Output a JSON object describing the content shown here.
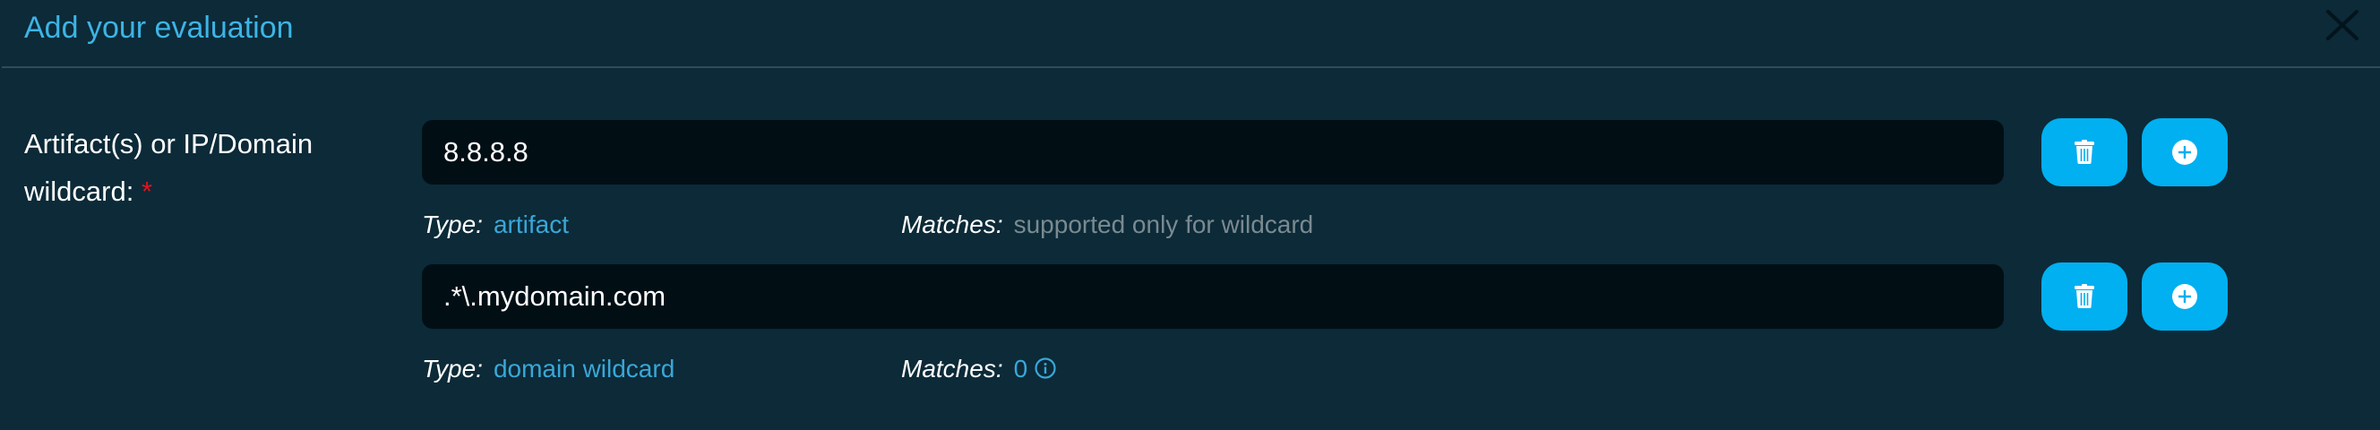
{
  "dialog": {
    "title": "Add your evaluation",
    "close_icon": "close-icon"
  },
  "field": {
    "label": "Artifact(s) or IP/Domain wildcard:",
    "required_mark": "*"
  },
  "rows": [
    {
      "value": "8.8.8.8",
      "type_label": "Type:",
      "type_value": "artifact",
      "matches_label": "Matches:",
      "matches_value": "supported only for wildcard"
    },
    {
      "value": ".*\\.mydomain.com",
      "type_label": "Type:",
      "type_value": "domain wildcard",
      "matches_label": "Matches:",
      "matches_value": "0"
    }
  ],
  "colors": {
    "background": "#0c2a38",
    "accent": "#00b0f0",
    "title": "#3db4e5",
    "input_bg": "#010f15"
  }
}
